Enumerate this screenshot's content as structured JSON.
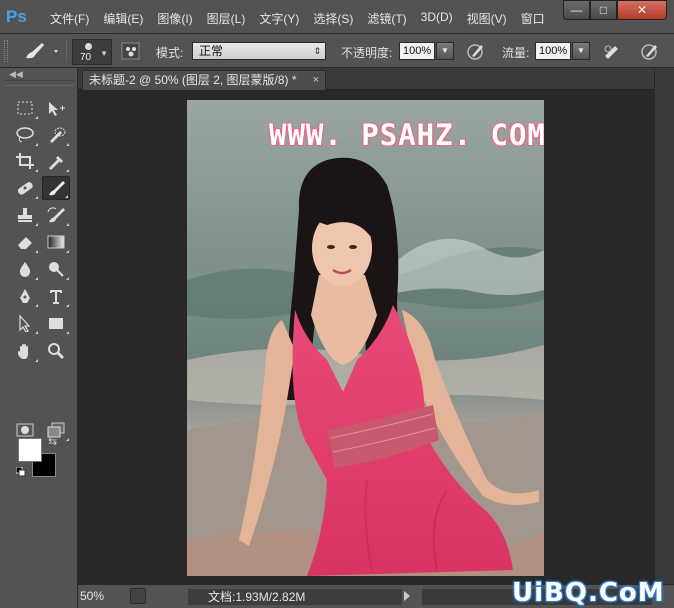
{
  "app": {
    "logo": "Ps"
  },
  "menu": [
    "文件(F)",
    "编辑(E)",
    "图像(I)",
    "图层(L)",
    "文字(Y)",
    "选择(S)",
    "滤镜(T)",
    "3D(D)",
    "视图(V)",
    "窗口"
  ],
  "window_controls": {
    "minimize": "—",
    "maximize": "□",
    "close": "✕"
  },
  "options": {
    "brush_size": "70",
    "mode_label": "模式:",
    "mode_value": "正常",
    "opacity_label": "不透明度:",
    "opacity_value": "100%",
    "flow_label": "流量:",
    "flow_value": "100%"
  },
  "document": {
    "tab_title": "未标题-2 @ 50% (图层 2, 图层蒙版/8) *",
    "tab_close": "×",
    "image_watermark": "WWW. PSAHZ. COM"
  },
  "status": {
    "zoom": "50%",
    "doc_info": "文档:1.93M/2.82M"
  },
  "site_watermark": "UiBQ.CoM",
  "colors": {
    "foreground": "#ffffff",
    "background": "#000000",
    "logo": "#4aa3e8",
    "dress": "#e8406f"
  }
}
